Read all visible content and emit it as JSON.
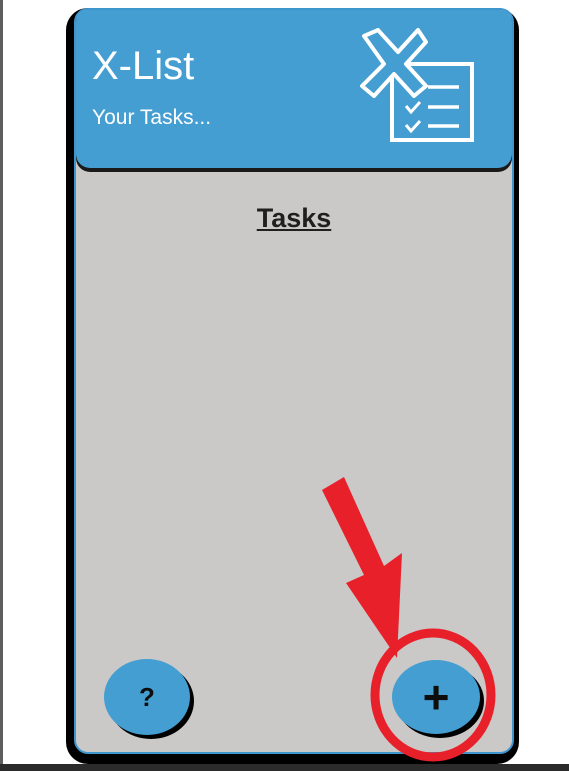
{
  "app": {
    "title": "X-List",
    "subtitle": "Your Tasks...",
    "logo_icon": "x-checklist-icon"
  },
  "main": {
    "section_title": "Tasks"
  },
  "buttons": {
    "help_label": "?",
    "add_label": "+"
  },
  "annotation": {
    "arrow_icon": "red-arrow-pointer",
    "highlight_icon": "red-circle-highlight"
  },
  "colors": {
    "header_blue": "#449ed2",
    "body_gray": "#cbc9c8",
    "annotation_red": "#e8202a"
  }
}
